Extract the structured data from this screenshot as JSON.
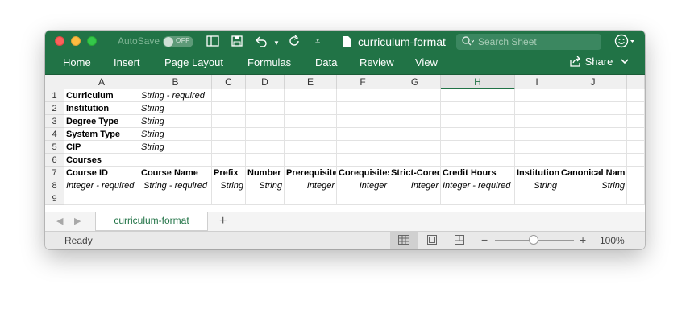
{
  "titlebar": {
    "autosave_label": "AutoSave",
    "autosave_state": "OFF",
    "doc_title": "curriculum-format",
    "search_placeholder": "Search Sheet"
  },
  "ribbon": {
    "tabs": [
      "Home",
      "Insert",
      "Page Layout",
      "Formulas",
      "Data",
      "Review",
      "View"
    ],
    "share_label": "Share"
  },
  "grid": {
    "columns": [
      "A",
      "B",
      "C",
      "D",
      "E",
      "F",
      "G",
      "H",
      "I",
      "J"
    ],
    "selected_column": "H",
    "rows": [
      "1",
      "2",
      "3",
      "4",
      "5",
      "6",
      "7",
      "8",
      "9"
    ],
    "cells": {
      "A1": "Curriculum",
      "B1": "String - required",
      "A2": "Institution",
      "B2": "String",
      "A3": "Degree Type",
      "B3": "String",
      "A4": "System Type",
      "B4": "String",
      "A5": "CIP",
      "B5": "String",
      "A6": "Courses",
      "A7": "Course ID",
      "B7": "Course Name",
      "C7": "Prefix",
      "D7": "Number",
      "E7": "Prerequisites",
      "F7": "Corequisites",
      "G7": "Strict-Corequisites",
      "H7": "Credit Hours",
      "I7": "Institution",
      "J7": "Canonical Name",
      "A8": "Integer - required",
      "B8": "String - required",
      "C8": "String",
      "D8": "String",
      "E8": "Integer",
      "F8": "Integer",
      "G8": "Integer",
      "H8": "Integer - required",
      "I8": "String",
      "J8": "String"
    }
  },
  "sheets": {
    "active": "curriculum-format"
  },
  "status": {
    "ready": "Ready",
    "zoom": "100%"
  },
  "colors": {
    "brand_green": "#217346"
  }
}
